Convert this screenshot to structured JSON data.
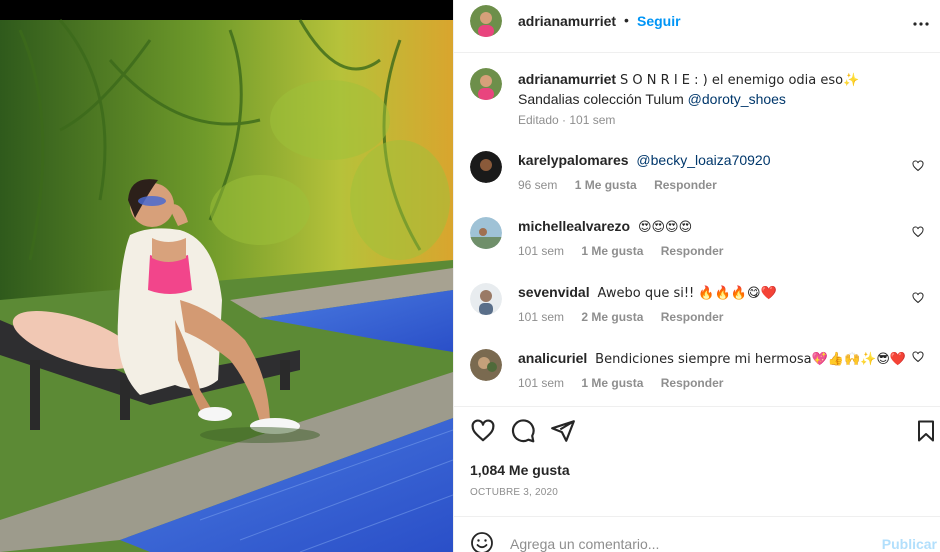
{
  "header": {
    "username": "adrianamurriet",
    "dot": "•",
    "follow_label": "Seguir",
    "more_icon": "more-horizontal-icon"
  },
  "caption": {
    "username": "adrianamurriet",
    "text": "S O N R I E : ) el enemigo odia eso✨",
    "text2": "Sandalias colección Tulum",
    "mention": "@doroty_shoes",
    "meta": "Editado · 101 sem"
  },
  "comments": [
    {
      "username": "karelypalomares",
      "mention": "@becky_loaiza70920",
      "text": "",
      "time": "96 sem",
      "likes": "1 Me gusta",
      "reply": "Responder"
    },
    {
      "username": "michellealvarezo",
      "mention": "",
      "text": "😍😍😍😍",
      "time": "101 sem",
      "likes": "1 Me gusta",
      "reply": "Responder"
    },
    {
      "username": "sevenvidal",
      "mention": "",
      "text": "Awebo que si!! 🔥🔥🔥😋❤️",
      "time": "101 sem",
      "likes": "2 Me gusta",
      "reply": "Responder"
    },
    {
      "username": "analicuriel",
      "mention": "",
      "text": "Bendiciones siempre mi hermosa💖👍🙌✨😎❤️",
      "time": "101 sem",
      "likes": "1 Me gusta",
      "reply": "Responder"
    }
  ],
  "actions": {
    "like_icon": "heart-icon",
    "comment_icon": "comment-icon",
    "share_icon": "paper-plane-icon",
    "save_icon": "bookmark-icon"
  },
  "likes_count": "1,084 Me gusta",
  "date": "OCTUBRE 3, 2020",
  "comment_box": {
    "placeholder": "Agrega un comentario...",
    "publish_label": "Publicar"
  },
  "colors": {
    "link_blue": "#0095f6",
    "mention_blue": "#00376b",
    "muted": "#8e8e8e",
    "publish_disabled": "#b2dffc"
  }
}
